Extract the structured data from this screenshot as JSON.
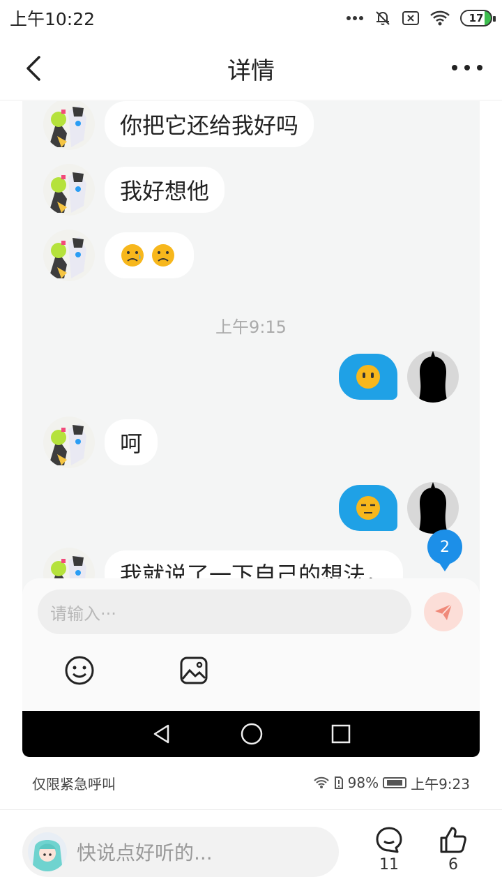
{
  "status_bar": {
    "time": "上午10:22",
    "battery": "17"
  },
  "nav": {
    "title": "详情"
  },
  "chat": {
    "messages": [
      {
        "side": "left",
        "text": "你把它还给我好吗"
      },
      {
        "side": "left",
        "text": "我好想他"
      },
      {
        "side": "left",
        "emoji": "😟😟"
      },
      {
        "side": "right",
        "emoji": "😶"
      },
      {
        "side": "left",
        "text": "呵"
      },
      {
        "side": "right",
        "emoji": "😒"
      },
      {
        "side": "left",
        "text": "我就说了一下自己的想法，"
      }
    ],
    "time_divider": "上午9:15",
    "unread_badge": "2",
    "input_placeholder": "请输入···"
  },
  "inner_status": {
    "left": "仅限紧急呼叫",
    "battery_pct": "98%",
    "time": "上午9:23"
  },
  "bottom_bar": {
    "comment_placeholder": "快说点好听的...",
    "comment_count": "11",
    "like_count": "6"
  },
  "colors": {
    "bubble_right": "#1fa1e6",
    "badge": "#1c8fe8",
    "send": "#f08a7a"
  }
}
